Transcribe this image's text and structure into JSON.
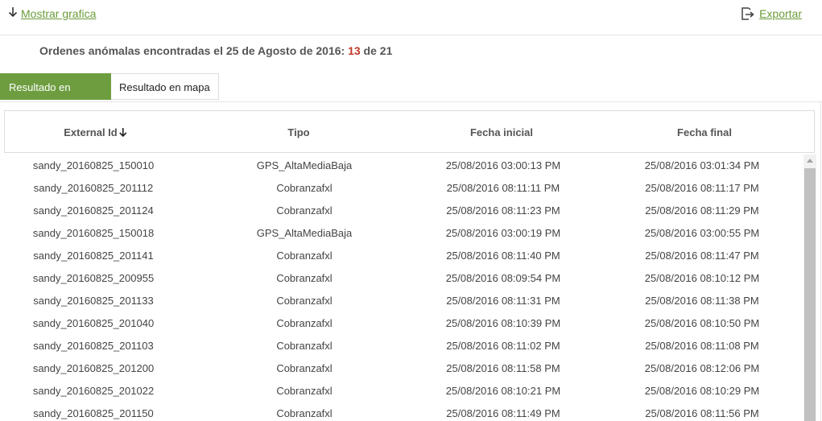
{
  "toolbar": {
    "show_chart_label": "Mostrar grafica",
    "export_label": "Exportar"
  },
  "summary": {
    "prefix": "Ordenes anómalas encontradas el 25 de Agosto de 2016: ",
    "found": "13",
    "middle": " de ",
    "total": "21"
  },
  "tabs": [
    {
      "label": "Resultado en listado",
      "active": true
    },
    {
      "label": "Resultado en mapa",
      "active": false
    }
  ],
  "table": {
    "columns": [
      "External Id",
      "Tipo",
      "Fecha inicial",
      "Fecha final"
    ],
    "rows": [
      [
        "sandy_20160825_150010",
        "GPS_AltaMediaBaja",
        "25/08/2016 03:00:13 PM",
        "25/08/2016 03:01:34 PM"
      ],
      [
        "sandy_20160825_201112",
        "Cobranzafxl",
        "25/08/2016 08:11:11 PM",
        "25/08/2016 08:11:17 PM"
      ],
      [
        "sandy_20160825_201124",
        "Cobranzafxl",
        "25/08/2016 08:11:23 PM",
        "25/08/2016 08:11:29 PM"
      ],
      [
        "sandy_20160825_150018",
        "GPS_AltaMediaBaja",
        "25/08/2016 03:00:19 PM",
        "25/08/2016 03:00:55 PM"
      ],
      [
        "sandy_20160825_201141",
        "Cobranzafxl",
        "25/08/2016 08:11:40 PM",
        "25/08/2016 08:11:47 PM"
      ],
      [
        "sandy_20160825_200955",
        "Cobranzafxl",
        "25/08/2016 08:09:54 PM",
        "25/08/2016 08:10:12 PM"
      ],
      [
        "sandy_20160825_201133",
        "Cobranzafxl",
        "25/08/2016 08:11:31 PM",
        "25/08/2016 08:11:38 PM"
      ],
      [
        "sandy_20160825_201040",
        "Cobranzafxl",
        "25/08/2016 08:10:39 PM",
        "25/08/2016 08:10:50 PM"
      ],
      [
        "sandy_20160825_201103",
        "Cobranzafxl",
        "25/08/2016 08:11:02 PM",
        "25/08/2016 08:11:08 PM"
      ],
      [
        "sandy_20160825_201200",
        "Cobranzafxl",
        "25/08/2016 08:11:58 PM",
        "25/08/2016 08:12:06 PM"
      ],
      [
        "sandy_20160825_201022",
        "Cobranzafxl",
        "25/08/2016 08:10:21 PM",
        "25/08/2016 08:10:29 PM"
      ],
      [
        "sandy_20160825_201150",
        "Cobranzafxl",
        "25/08/2016 08:11:49 PM",
        "25/08/2016 08:11:56 PM"
      ]
    ]
  },
  "icons": {
    "show_chart": "arrow-down-icon",
    "export": "export-icon",
    "sort": "sort-desc-icon"
  },
  "colors": {
    "accent": "#6e9d40",
    "link": "#6a9b3a",
    "highlight": "#c0392b"
  }
}
